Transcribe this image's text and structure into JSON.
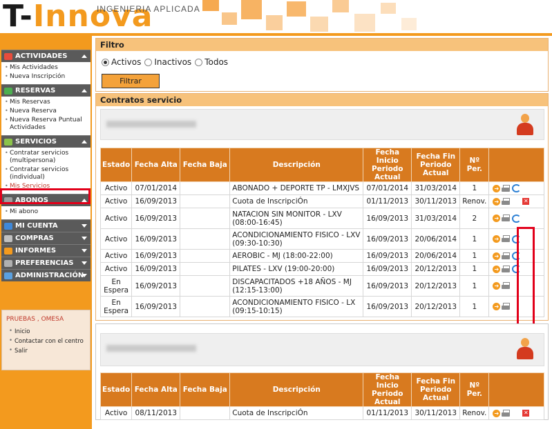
{
  "header": {
    "logo_left": "T-",
    "logo_right": "Innova",
    "tagline": "INGENIERIA APLICADA"
  },
  "sidebar": {
    "sections": [
      {
        "label": "ACTIVIDADES",
        "icon": "calendar-icon",
        "icon_color": "#e74c3c",
        "expanded": true,
        "items": [
          "Mis Actividades",
          "Nueva Inscripción"
        ]
      },
      {
        "label": "RESERVAS",
        "icon": "grid-icon",
        "icon_color": "#4caf50",
        "expanded": true,
        "items": [
          "Mis Reservas",
          "Nueva Reserva",
          "Nueva Reserva Puntual Actividades"
        ]
      },
      {
        "label": "SERVICIOS",
        "icon": "services-icon",
        "icon_color": "#8bc34a",
        "expanded": true,
        "items": [
          "Contratar servicios (multipersona)",
          "Contratar servicios (individual)",
          "Mis Servicios"
        ],
        "active_item": "Mis Servicios"
      },
      {
        "label": "ABONOS",
        "icon": "card-icon",
        "icon_color": "#9e9e9e",
        "expanded": true,
        "items": [
          "Mi abono"
        ]
      },
      {
        "label": "MI CUENTA",
        "icon": "user-icon",
        "icon_color": "#3f88d8",
        "expanded": false,
        "items": []
      },
      {
        "label": "COMPRAS",
        "icon": "cart-icon",
        "icon_color": "#c0c0c0",
        "expanded": false,
        "items": []
      },
      {
        "label": "INFORMES",
        "icon": "chart-icon",
        "icon_color": "#f39a1e",
        "expanded": false,
        "items": []
      },
      {
        "label": "PREFERENCIAS",
        "icon": "wrench-icon",
        "icon_color": "#b0b0b0",
        "expanded": false,
        "items": []
      },
      {
        "label": "ADMINISTRACIÓN",
        "icon": "globe-icon",
        "icon_color": "#5aa0e0",
        "expanded": false,
        "items": []
      }
    ],
    "user": {
      "name": "PRUEBAS , OMESA",
      "links": [
        "Inicio",
        "Contactar con el centro",
        "Salir"
      ]
    }
  },
  "filter": {
    "title": "Filtro",
    "options": [
      "Activos",
      "Inactivos",
      "Todos"
    ],
    "selected": "Activos",
    "button": "Filtrar"
  },
  "contracts": {
    "title": "Contratos servicio",
    "columns": [
      "Estado",
      "Fecha Alta",
      "Fecha Baja",
      "Descripción",
      "Fecha Inicio Periodo Actual",
      "Fecha Fin Periodo Actual",
      "Nº Per."
    ],
    "groups": [
      {
        "rows": [
          {
            "estado": "Activo",
            "alta": "07/01/2014",
            "baja": "",
            "desc": "ABONADO + DEPORTE TP - LMXJVS",
            "inicio": "07/01/2014",
            "fin": "31/03/2014",
            "per": "1",
            "renew": true,
            "delete": false
          },
          {
            "estado": "Activo",
            "alta": "16/09/2013",
            "baja": "",
            "desc": "Cuota de InscripciÓn",
            "inicio": "01/11/2013",
            "fin": "30/11/2013",
            "per": "Renov.",
            "renew": false,
            "delete": true
          },
          {
            "estado": "Activo",
            "alta": "16/09/2013",
            "baja": "",
            "desc": "NATACION SIN MONITOR - LXV (08:00-16:45)",
            "inicio": "16/09/2013",
            "fin": "31/03/2014",
            "per": "2",
            "renew": true,
            "delete": false
          },
          {
            "estado": "Activo",
            "alta": "16/09/2013",
            "baja": "",
            "desc": "ACONDICIONAMIENTO FISICO - LXV (09:30-10:30)",
            "inicio": "16/09/2013",
            "fin": "20/06/2014",
            "per": "1",
            "renew": true,
            "delete": false
          },
          {
            "estado": "Activo",
            "alta": "16/09/2013",
            "baja": "",
            "desc": "AEROBIC - MJ (18:00-22:00)",
            "inicio": "16/09/2013",
            "fin": "20/06/2014",
            "per": "1",
            "renew": true,
            "delete": false
          },
          {
            "estado": "Activo",
            "alta": "16/09/2013",
            "baja": "",
            "desc": "PILATES - LXV (19:00-20:00)",
            "inicio": "16/09/2013",
            "fin": "20/12/2013",
            "per": "1",
            "renew": true,
            "delete": false
          },
          {
            "estado": "En Espera",
            "alta": "16/09/2013",
            "baja": "",
            "desc": "DISCAPACITADOS +18 AÑOS - MJ (12:15-13:00)",
            "inicio": "16/09/2013",
            "fin": "20/12/2013",
            "per": "1",
            "renew": false,
            "delete": false
          },
          {
            "estado": "En Espera",
            "alta": "16/09/2013",
            "baja": "",
            "desc": "ACONDICIONAMIENTO FISICO - LX (09:15-10:15)",
            "inicio": "16/09/2013",
            "fin": "20/12/2013",
            "per": "1",
            "renew": false,
            "delete": false
          }
        ]
      },
      {
        "rows": [
          {
            "estado": "Activo",
            "alta": "08/11/2013",
            "baja": "",
            "desc": "Cuota de InscripciÓn",
            "inicio": "01/11/2013",
            "fin": "30/11/2013",
            "per": "Renov.",
            "renew": false,
            "delete": true
          }
        ]
      }
    ]
  },
  "colors": {
    "accent": "#f39a1e",
    "table_header": "#d87a1f",
    "highlight": "#e2001a"
  }
}
